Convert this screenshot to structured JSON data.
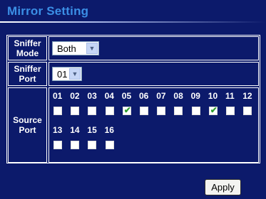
{
  "title": "Mirror Setting",
  "sniffer_mode": {
    "label_line1": "Sniffer",
    "label_line2": "Mode",
    "value": "Both"
  },
  "sniffer_port": {
    "label_line1": "Sniffer",
    "label_line2": "Port",
    "value": "01"
  },
  "source_port": {
    "label_line1": "Source",
    "label_line2": "Port",
    "ports": [
      {
        "num": "01",
        "checked": false
      },
      {
        "num": "02",
        "checked": false
      },
      {
        "num": "03",
        "checked": false
      },
      {
        "num": "04",
        "checked": false
      },
      {
        "num": "05",
        "checked": true
      },
      {
        "num": "06",
        "checked": false
      },
      {
        "num": "07",
        "checked": false
      },
      {
        "num": "08",
        "checked": false
      },
      {
        "num": "09",
        "checked": false
      },
      {
        "num": "10",
        "checked": true
      },
      {
        "num": "11",
        "checked": false
      },
      {
        "num": "12",
        "checked": false
      },
      {
        "num": "13",
        "checked": false
      },
      {
        "num": "14",
        "checked": false
      },
      {
        "num": "15",
        "checked": false
      },
      {
        "num": "16",
        "checked": false
      }
    ]
  },
  "apply_label": "Apply",
  "colors": {
    "background": "#0c1a6b",
    "title": "#3b8fe6",
    "check": "#2e9d2e"
  }
}
